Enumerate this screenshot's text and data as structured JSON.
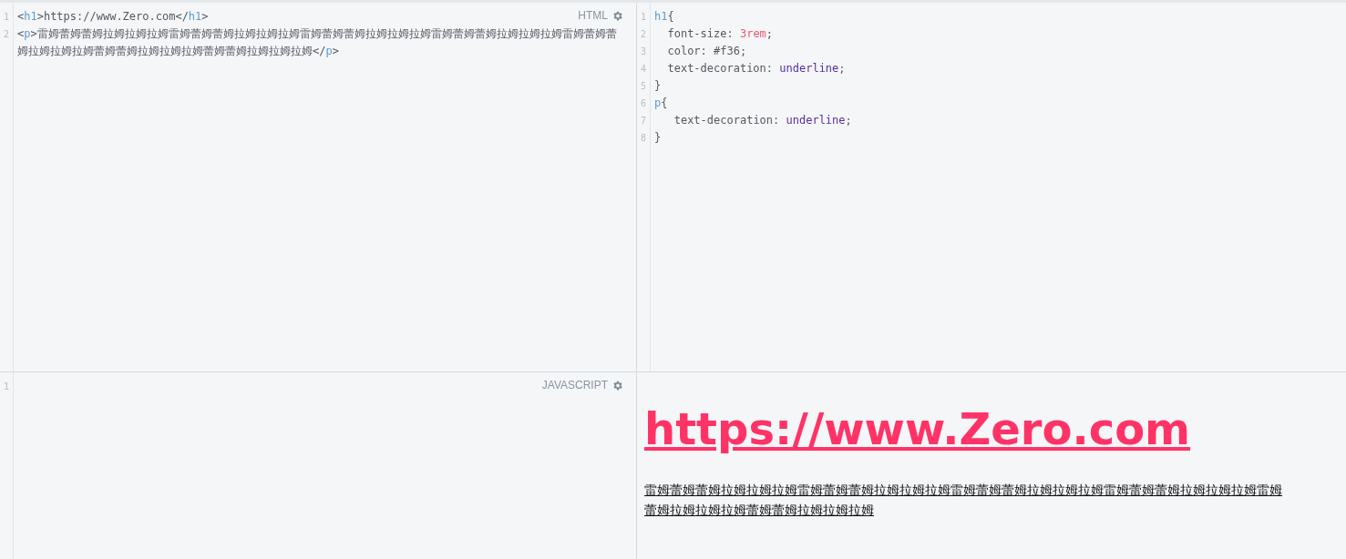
{
  "html_editor": {
    "label": "HTML",
    "lines": [
      {
        "number": "1",
        "tokens": [
          {
            "kind": "punct",
            "text": "<"
          },
          {
            "kind": "tag",
            "text": "h1"
          },
          {
            "kind": "punct",
            "text": ">https://www.Zero.com</"
          },
          {
            "kind": "tag",
            "text": "h1"
          },
          {
            "kind": "punct",
            "text": ">"
          }
        ]
      },
      {
        "number": "2",
        "tokens": [
          {
            "kind": "punct",
            "text": "<"
          },
          {
            "kind": "tag",
            "text": "p"
          },
          {
            "kind": "punct",
            "text": ">雷姆蕾姆蕾姆拉姆拉姆拉姆雷姆蕾姆蕾姆拉姆拉姆拉姆雷姆蕾姆蕾姆拉姆拉姆拉姆雷姆蕾姆蕾姆拉姆拉姆拉姆雷姆蕾姆蕾姆拉姆拉姆拉姆蕾姆蕾姆拉姆拉姆拉姆蕾姆蕾姆拉姆拉姆拉姆</"
          },
          {
            "kind": "tag",
            "text": "p"
          },
          {
            "kind": "punct",
            "text": ">"
          }
        ]
      }
    ]
  },
  "css_editor": {
    "lines": [
      {
        "number": "1",
        "tokens": [
          {
            "kind": "tag",
            "text": "h1"
          },
          {
            "kind": "punct",
            "text": "{"
          }
        ]
      },
      {
        "number": "2",
        "tokens": [
          {
            "kind": "punct",
            "text": "  font-size: "
          },
          {
            "kind": "number",
            "text": "3rem"
          },
          {
            "kind": "punct",
            "text": ";"
          }
        ]
      },
      {
        "number": "3",
        "tokens": [
          {
            "kind": "punct",
            "text": "  color: #f36;"
          }
        ]
      },
      {
        "number": "4",
        "tokens": [
          {
            "kind": "punct",
            "text": "  text-decoration: "
          },
          {
            "kind": "keyword",
            "text": "underline"
          },
          {
            "kind": "punct",
            "text": ";"
          }
        ]
      },
      {
        "number": "5",
        "tokens": [
          {
            "kind": "punct",
            "text": "}"
          }
        ]
      },
      {
        "number": "6",
        "tokens": [
          {
            "kind": "tag",
            "text": "p"
          },
          {
            "kind": "punct",
            "text": "{"
          }
        ]
      },
      {
        "number": "7",
        "tokens": [
          {
            "kind": "punct",
            "text": "   text-decoration: "
          },
          {
            "kind": "keyword",
            "text": "underline"
          },
          {
            "kind": "punct",
            "text": ";"
          }
        ]
      },
      {
        "number": "8",
        "tokens": [
          {
            "kind": "punct",
            "text": "}"
          }
        ]
      }
    ]
  },
  "js_editor": {
    "label": "JAVASCRIPT",
    "lines": [
      {
        "number": "1"
      }
    ]
  },
  "preview": {
    "heading": "https://www.Zero.com",
    "paragraph_lines": [
      "雷姆蕾姆蕾姆拉姆拉姆拉姆雷姆蕾姆蕾姆拉姆拉姆拉姆雷姆蕾姆蕾姆拉姆拉姆拉姆雷姆蕾姆蕾姆拉姆拉姆拉姆雷姆",
      "蕾姆拉姆拉姆拉姆蕾姆蕾姆拉姆拉姆拉姆"
    ]
  }
}
